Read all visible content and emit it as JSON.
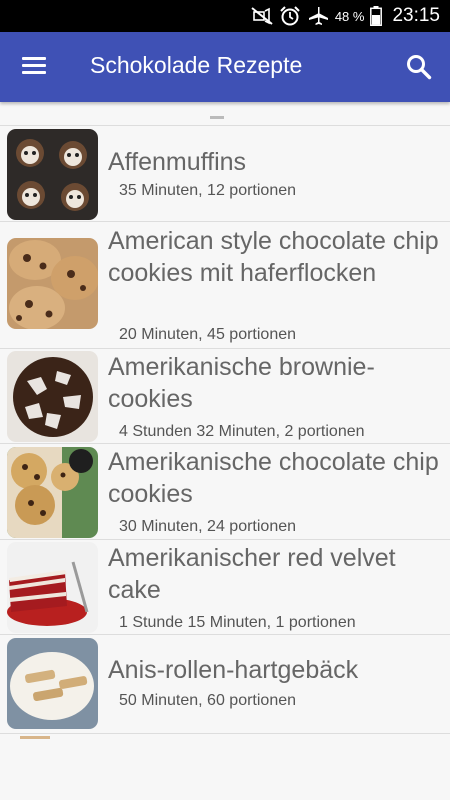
{
  "status_bar": {
    "battery_percent": "48 %",
    "time": "23:15",
    "icons": [
      "mute-icon",
      "alarm-icon",
      "airplane-icon",
      "battery-icon"
    ]
  },
  "app_bar": {
    "title": "Schokolade Rezepte",
    "background_color": "#3f51b5",
    "icons": [
      "menu-icon",
      "search-icon"
    ]
  },
  "recipes": [
    {
      "title": "Affenmuffins",
      "meta": "35 Minuten, 12 portionen"
    },
    {
      "title": "American style chocolate chip cookies mit haferflocken",
      "meta": "20 Minuten, 45 portionen"
    },
    {
      "title": "Amerikanische brownie-cookies",
      "meta": "4 Stunden 32 Minuten, 2 portionen"
    },
    {
      "title": "Amerikanische chocolate chip cookies",
      "meta": "30 Minuten, 24 portionen"
    },
    {
      "title": "Amerikanischer red velvet cake",
      "meta": "1 Stunde 15 Minuten, 1 portionen"
    },
    {
      "title": "Anis-rollen-hartgebäck",
      "meta": "50 Minuten, 60 portionen"
    }
  ]
}
